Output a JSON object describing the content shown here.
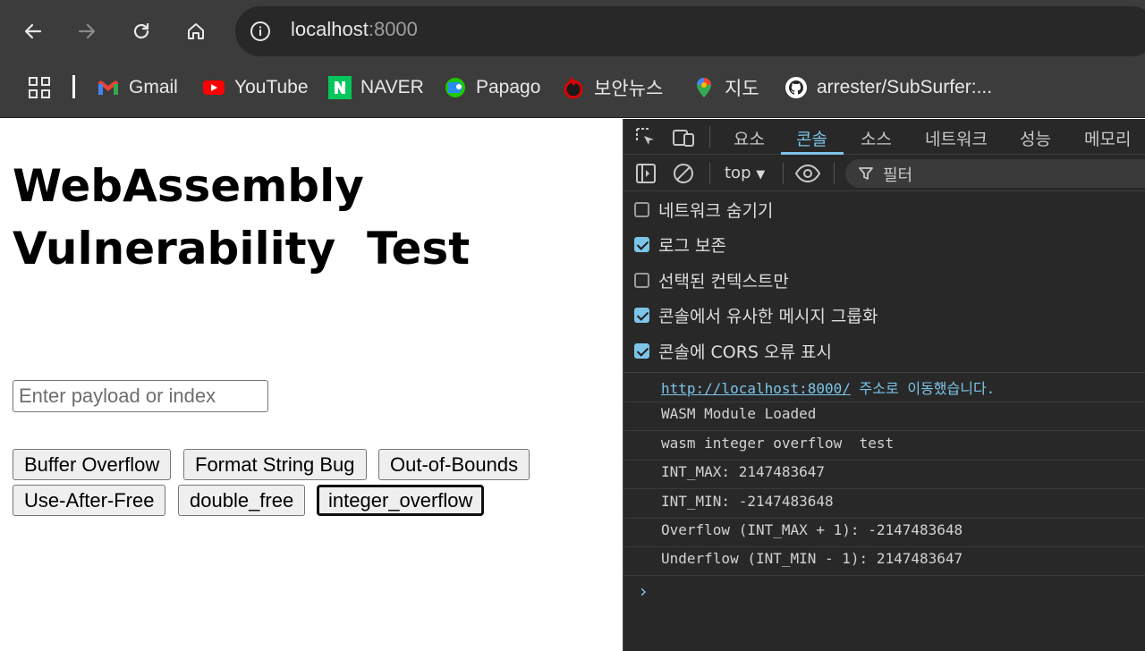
{
  "browser": {
    "url_host": "localhost",
    "url_port": ":8000"
  },
  "bookmarks": [
    {
      "label": "Gmail",
      "icon": "gmail-icon"
    },
    {
      "label": "YouTube",
      "icon": "youtube-icon"
    },
    {
      "label": "NAVER",
      "icon": "naver-icon"
    },
    {
      "label": "Papago",
      "icon": "papago-icon"
    },
    {
      "label": "보안뉴스",
      "icon": "boannews-icon"
    },
    {
      "label": "지도",
      "icon": "maps-icon"
    },
    {
      "label": "arrester/SubSurfer:...",
      "icon": "github-icon"
    }
  ],
  "page": {
    "title_line1": "WebAssembly",
    "title_line2": "Vulnerability  Test",
    "input_placeholder": "Enter payload or index",
    "buttons": [
      "Buffer Overflow",
      "Format String Bug",
      "Out-of-Bounds",
      "Use-After-Free",
      "double_free",
      "integer_overflow"
    ]
  },
  "devtools": {
    "tabs": [
      "요소",
      "콘솔",
      "소스",
      "네트워크",
      "성능",
      "메모리"
    ],
    "active_tab": "콘솔",
    "context": "top",
    "filter_placeholder": "필터",
    "settings": [
      {
        "label": "네트워크 숨기기",
        "checked": false
      },
      {
        "label": "로그 보존",
        "checked": true
      },
      {
        "label": "선택된 컨텍스트만",
        "checked": false
      },
      {
        "label": "콘솔에서 유사한 메시지 그룹화",
        "checked": true
      },
      {
        "label": "콘솔에 CORS 오류 표시",
        "checked": true
      }
    ],
    "console": {
      "nav_link": "http://localhost:8000/",
      "nav_suffix": " 주소로 이동했습니다.",
      "logs": [
        "WASM Module Loaded",
        "wasm integer overflow  test",
        "INT_MAX: 2147483647",
        "INT_MIN: -2147483648",
        "Overflow (INT_MAX + 1): -2147483648",
        "Underflow (INT_MIN - 1): 2147483647"
      ]
    }
  },
  "colors": {
    "chrome_bg": "#3c3c3c",
    "devtools_bg": "#282828",
    "accent": "#7cc4e8"
  }
}
